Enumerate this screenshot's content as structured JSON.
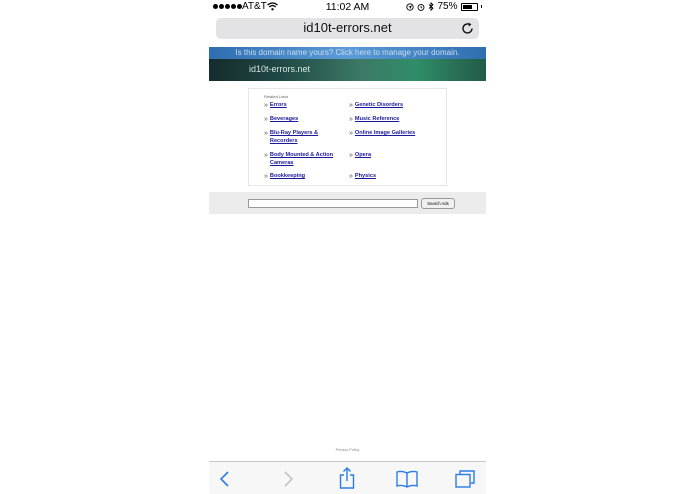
{
  "status_bar": {
    "carrier": "AT&T",
    "time": "11:02 AM",
    "battery_percent": "75%",
    "battery_level": 0.75
  },
  "browser": {
    "url": "id10t-errors.net"
  },
  "banner": {
    "notice": "Is this domain name yours? Click here to manage your domain.",
    "domain": "id10t-errors.net"
  },
  "links": {
    "heading": "Related Links",
    "left": [
      "Errors",
      "Beverages",
      "Blu-Ray Players & Recorders",
      "Body Mounted & Action Cameras",
      "Bookkeeping"
    ],
    "right": [
      "Genetic Disorders",
      "Music Reference",
      "Online Image Galleries",
      "Opera",
      "Physics"
    ],
    "arrow": "»"
  },
  "search": {
    "input_value": "",
    "button_label": "Search Ads"
  },
  "footer": {
    "privacy": "Privacy Policy"
  },
  "icons": {
    "wifi": "wifi-icon",
    "location": "location-icon",
    "alarm": "alarm-icon",
    "bluetooth": "bluetooth-icon",
    "reload": "reload-icon",
    "back": "back-chevron-icon",
    "forward": "forward-chevron-icon",
    "share": "share-icon",
    "bookmarks": "bookmarks-icon",
    "tabs": "tabs-icon"
  },
  "colors": {
    "link": "#1a1a99",
    "ios_blue": "#2c7be5"
  }
}
